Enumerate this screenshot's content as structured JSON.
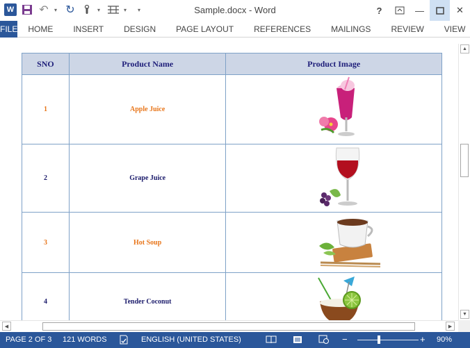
{
  "app": {
    "title": "Sample.docx - Word"
  },
  "qat": {
    "logo": "W"
  },
  "window": {
    "help": "?",
    "minimize": "—",
    "close": "✕"
  },
  "ribbon": {
    "file_tab": "FILE",
    "tabs": [
      "HOME",
      "INSERT",
      "DESIGN",
      "PAGE LAYOUT",
      "REFERENCES",
      "MAILINGS",
      "REVIEW",
      "VIEW"
    ]
  },
  "table": {
    "headers": [
      "SNO",
      "Product Name",
      "Product Image"
    ],
    "rows": [
      {
        "sno": "1",
        "name": "Apple Juice",
        "color": "#e8761b",
        "image": "pink-juice-glass-image"
      },
      {
        "sno": "2",
        "name": "Grape Juice",
        "color": "#1b1b6b",
        "image": "red-wine-glass-image"
      },
      {
        "sno": "3",
        "name": "Hot Soup",
        "color": "#e8761b",
        "image": "tea-cup-image"
      },
      {
        "sno": "4",
        "name": "Tender Coconut",
        "color": "#1b1b6b",
        "image": "coconut-drink-image"
      }
    ]
  },
  "status": {
    "page": "PAGE 2 OF 3",
    "words": "121 WORDS",
    "language": "ENGLISH (UNITED STATES)",
    "zoom": "90%",
    "zoom_minus": "−",
    "zoom_plus": "+",
    "zoom_level_percent": 90
  },
  "colors": {
    "accent": "#2b579a",
    "header_bg": "#cdd6e6",
    "border": "#7ea1c7"
  }
}
